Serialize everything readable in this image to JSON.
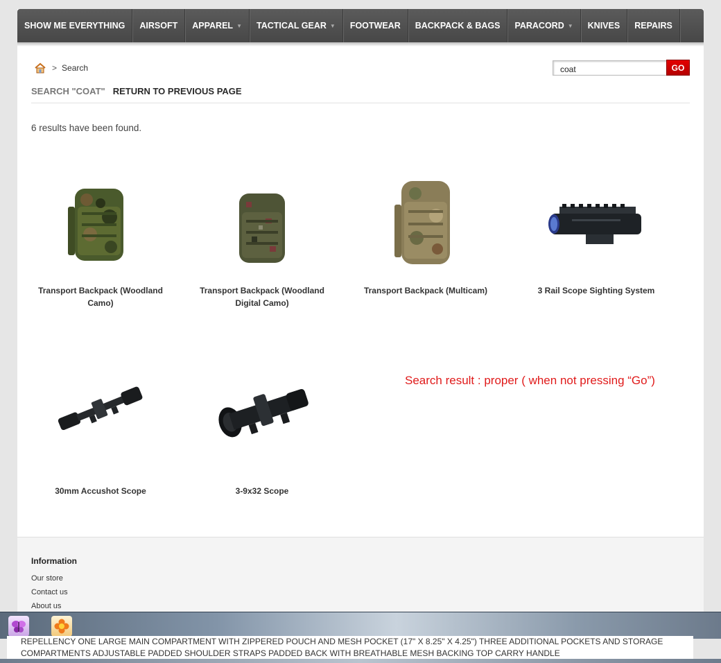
{
  "nav": {
    "items": [
      {
        "label": "SHOW ME EVERYTHING",
        "caret": ""
      },
      {
        "label": "AIRSOFT",
        "caret": ""
      },
      {
        "label": "APPAREL",
        "caret": "▼"
      },
      {
        "label": "TACTICAL GEAR",
        "caret": "▼"
      },
      {
        "label": "FOOTWEAR",
        "caret": ""
      },
      {
        "label": "BACKPACK & BAGS",
        "caret": ""
      },
      {
        "label": "PARACORD",
        "caret": "▼"
      },
      {
        "label": "KNIVES",
        "caret": ""
      },
      {
        "label": "REPAIRS",
        "caret": ""
      }
    ]
  },
  "breadcrumb": {
    "separator": ">",
    "current": "Search"
  },
  "search": {
    "value": "coat",
    "go_label": "GO"
  },
  "heading": {
    "query": "SEARCH \"COAT\"",
    "back_label": "RETURN TO PREVIOUS PAGE"
  },
  "results": {
    "count_text": "6 results have been found."
  },
  "products": [
    {
      "name": "Transport Backpack (Woodland Camo)",
      "icon": "backpack-woodland-image"
    },
    {
      "name": "Transport Backpack (Woodland Digital Camo)",
      "icon": "backpack-digital-camo-image"
    },
    {
      "name": "Transport Backpack (Multicam)",
      "icon": "backpack-multicam-image"
    },
    {
      "name": "3 Rail Scope Sighting System",
      "icon": "rail-scope-image"
    },
    {
      "name": "30mm Accushot Scope",
      "icon": "rifle-scope-image"
    },
    {
      "name": "3-9x32 Scope",
      "icon": "compact-scope-image"
    }
  ],
  "annotation": {
    "text": "Search result : proper ( when not pressing “Go”)",
    "color": "#e01a1a"
  },
  "footer": {
    "title": "Information",
    "links": [
      "Our store",
      "Contact us",
      "About us"
    ]
  },
  "taskbar": {
    "icons": [
      "butterfly-app-icon",
      "flower-app-icon"
    ]
  },
  "description": {
    "line1": "REPELLENCY ONE LARGE MAIN COMPARTMENT WITH ZIPPERED POUCH AND MESH POCKET (17\" X 8.25\" X 4.25\") THREE ADDITIONAL POCKETS AND STORAGE",
    "line2": "COMPARTMENTS ADJUSTABLE PADDED SHOULDER STRAPS PADDED BACK WITH BREATHABLE MESH BACKING TOP CARRY HANDLE"
  },
  "colors": {
    "nav_bg": "#4f4f4f",
    "go_button": "#d40000",
    "accent_red": "#e01a1a"
  }
}
